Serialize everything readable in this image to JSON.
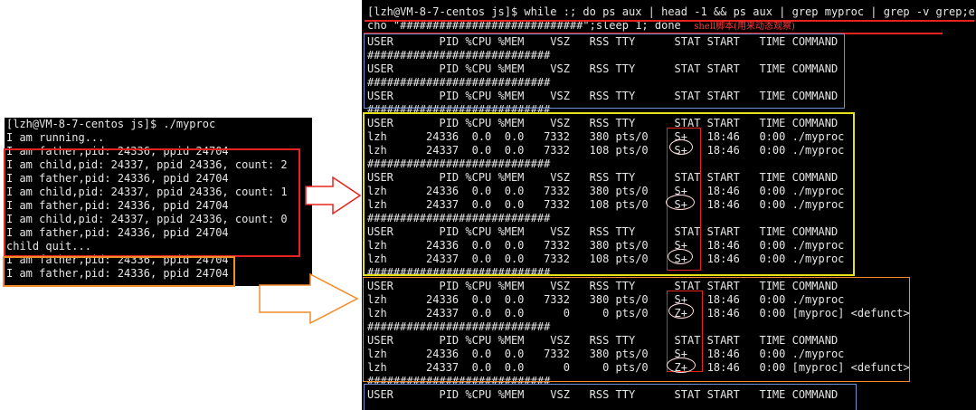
{
  "left_terminal": {
    "lines": [
      "[lzh@VM-8-7-centos js]$ ./myproc",
      "I am running...",
      "I am father,pid: 24336, ppid 24704",
      "I am child,pid: 24337, ppid 24336, count: 2",
      "I am father,pid: 24336, ppid 24704",
      "I am child,pid: 24337, ppid 24336, count: 1",
      "I am father,pid: 24336, ppid 24704",
      "I am child,pid: 24337, ppid 24336, count: 0",
      "I am father,pid: 24336, ppid 24704",
      "child quit...",
      "I am father,pid: 24336, ppid 24704",
      "I am father,pid: 24336, ppid 24704"
    ]
  },
  "right_terminal": {
    "command_line_1": "[lzh@VM-8-7-centos js]$ while :; do ps aux | head -1 && ps aux | grep myproc | grep -v grep;e",
    "command_line_2": "cho \"############################\";sleep 1; done",
    "annotation": "shell脚本(用来动态观察)",
    "lines": [
      "USER       PID %CPU %MEM    VSZ   RSS TTY      STAT START   TIME COMMAND",
      "############################",
      "USER       PID %CPU %MEM    VSZ   RSS TTY      STAT START   TIME COMMAND",
      "############################",
      "USER       PID %CPU %MEM    VSZ   RSS TTY      STAT START   TIME COMMAND",
      "############################",
      "USER       PID %CPU %MEM    VSZ   RSS TTY      STAT START   TIME COMMAND",
      "lzh      24336  0.0  0.0   7332   380 pts/0    S+   18:46   0:00 ./myproc",
      "lzh      24337  0.0  0.0   7332   108 pts/0    S+   18:46   0:00 ./myproc",
      "############################",
      "USER       PID %CPU %MEM    VSZ   RSS TTY      STAT START   TIME COMMAND",
      "lzh      24336  0.0  0.0   7332   380 pts/0    S+   18:46   0:00 ./myproc",
      "lzh      24337  0.0  0.0   7332   108 pts/0    S+   18:46   0:00 ./myproc",
      "############################",
      "USER       PID %CPU %MEM    VSZ   RSS TTY      STAT START   TIME COMMAND",
      "lzh      24336  0.0  0.0   7332   380 pts/0    S+   18:46   0:00 ./myproc",
      "lzh      24337  0.0  0.0   7332   108 pts/0    S+   18:46   0:00 ./myproc",
      "############################",
      "USER       PID %CPU %MEM    VSZ   RSS TTY      STAT START   TIME COMMAND",
      "lzh      24336  0.0  0.0   7332   380 pts/0    S+   18:46   0:00 ./myproc",
      "lzh      24337  0.0  0.0      0     0 pts/0    Z+   18:46   0:00 [myproc] <defunct>",
      "############################",
      "USER       PID %CPU %MEM    VSZ   RSS TTY      STAT START   TIME COMMAND",
      "lzh      24336  0.0  0.0   7332   380 pts/0    S+   18:46   0:00 ./myproc",
      "lzh      24337  0.0  0.0      0     0 pts/0    Z+   18:46   0:00 [myproc] <defunct>",
      "############################",
      "USER       PID %CPU %MEM    VSZ   RSS TTY      STAT START   TIME COMMAND"
    ]
  },
  "colors": {
    "red": "#e8231f",
    "orange": "#f28c28",
    "yellow": "#e6e21a",
    "blue": "#6f8fd0",
    "white_circle": "#ffdede"
  }
}
